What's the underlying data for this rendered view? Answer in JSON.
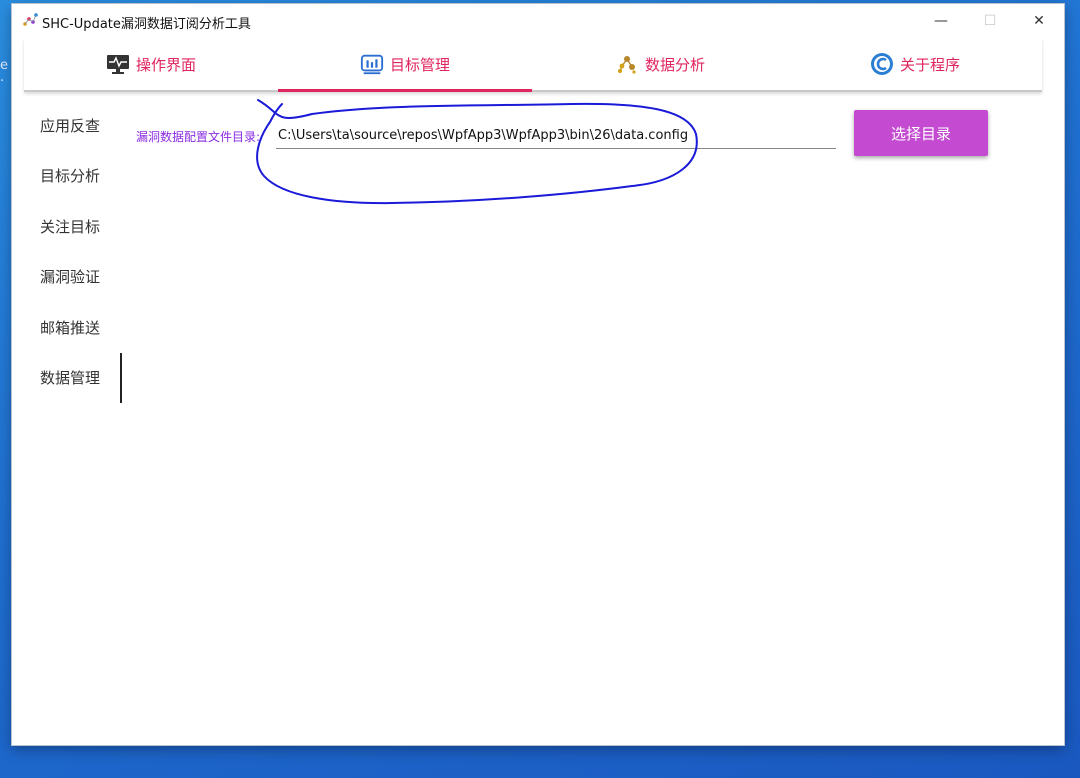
{
  "window": {
    "title": "SHC-Update漏洞数据订阅分析工具",
    "controls": {
      "minimize": "—",
      "maximize": "☐",
      "close": "✕"
    }
  },
  "tabs": [
    {
      "label": "操作界面",
      "icon": "monitor-icon",
      "active": false
    },
    {
      "label": "目标管理",
      "icon": "chart-icon",
      "active": true
    },
    {
      "label": "数据分析",
      "icon": "molecule-icon",
      "active": false
    },
    {
      "label": "关于程序",
      "icon": "about-icon",
      "active": false
    }
  ],
  "sidebar": {
    "items": [
      {
        "label": "应用反查",
        "active": false
      },
      {
        "label": "目标分析",
        "active": false
      },
      {
        "label": "关注目标",
        "active": false
      },
      {
        "label": "漏洞验证",
        "active": false
      },
      {
        "label": "邮箱推送",
        "active": false
      },
      {
        "label": "数据管理",
        "active": true
      }
    ]
  },
  "config": {
    "label": "漏洞数据配置文件目录:",
    "value": "C:\\Users\\ta\\source\\repos\\WpfApp3\\WpfApp3\\bin\\26\\data.config",
    "button": "选择目录"
  },
  "colors": {
    "accent": "#e0245e",
    "button": "#c44bd1",
    "label": "#8a2be2",
    "annotation": "#1a1ad8"
  }
}
